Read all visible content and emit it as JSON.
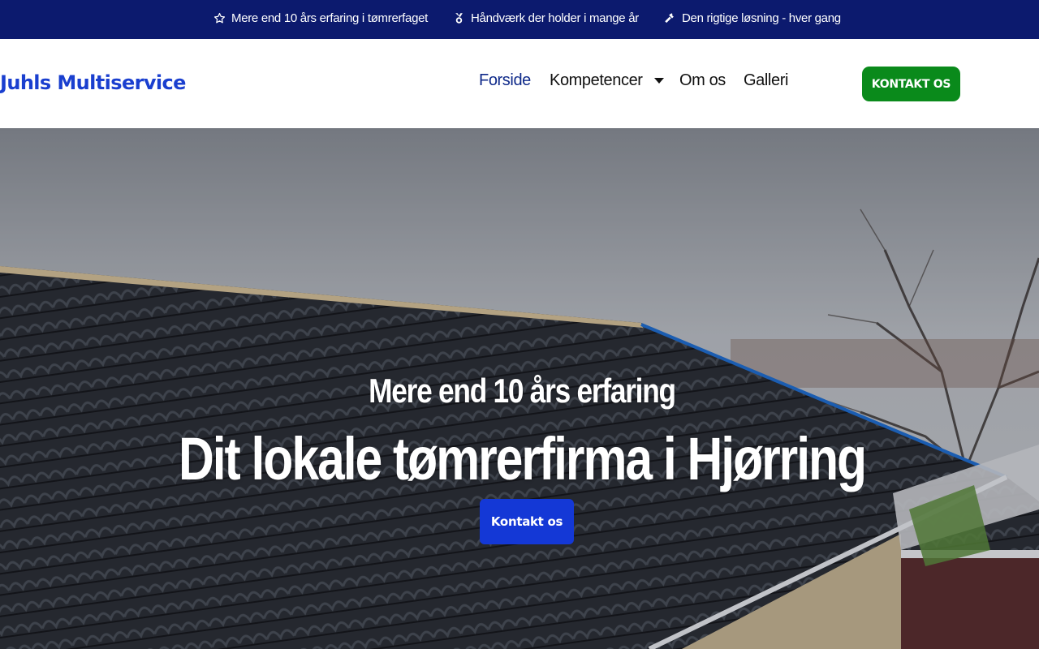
{
  "topbar": {
    "items": [
      {
        "icon": "star-outline-icon",
        "text": "Mere end 10 års erfaring i tømrerfaget"
      },
      {
        "icon": "medal-icon",
        "text": "Håndværk der holder i mange år"
      },
      {
        "icon": "hammer-icon",
        "text": "Den rigtige løsning - hver gang"
      }
    ]
  },
  "header": {
    "logo": "Juhls Multiservice",
    "nav": [
      {
        "label": "Forside",
        "active": true
      },
      {
        "label": "Kompetencer",
        "has_dropdown": true
      },
      {
        "label": "Om os"
      },
      {
        "label": "Galleri"
      }
    ],
    "cta": "KONTAKT OS"
  },
  "hero": {
    "subtitle": "Mere end 10 års erfaring",
    "title": "Dit lokale tømrerfirma i Hjørring",
    "cta": "Kontakt os"
  },
  "colors": {
    "topbar_bg": "#0c1a6e",
    "logo": "#1a3fcf",
    "nav_active": "#0f2a8a",
    "header_cta": "#0a8a1b",
    "hero_cta": "#1438d6"
  }
}
